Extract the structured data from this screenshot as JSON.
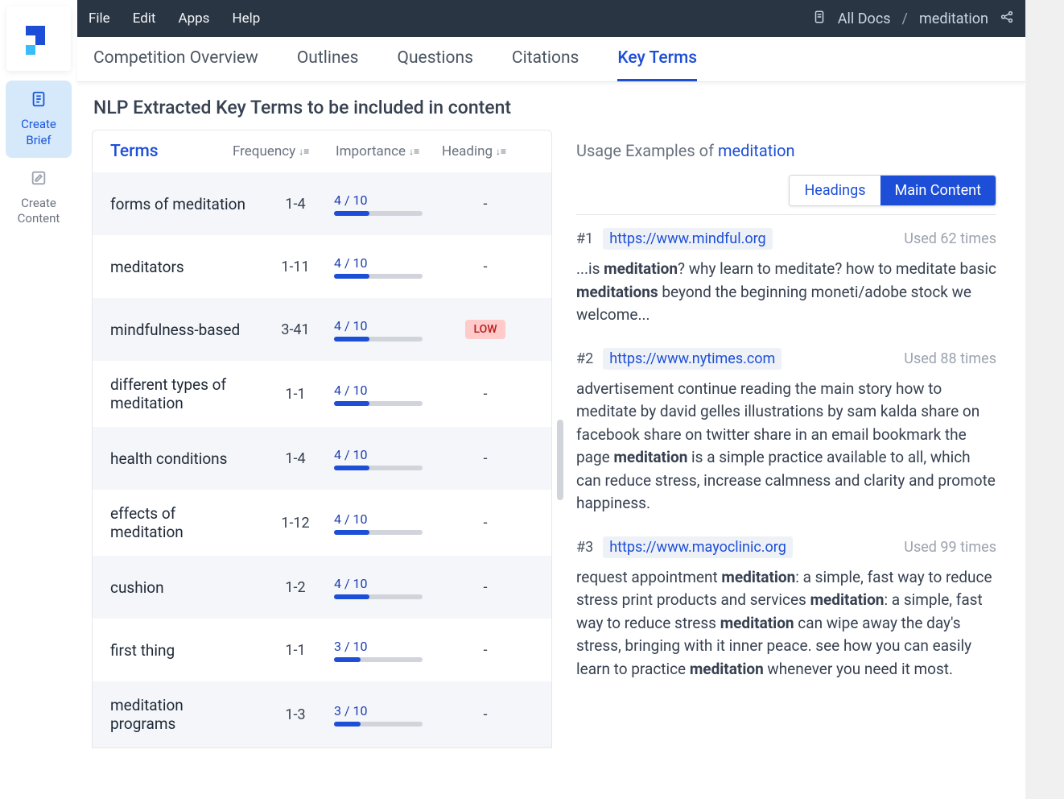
{
  "topmenu": {
    "file": "File",
    "edit": "Edit",
    "apps": "Apps",
    "help": "Help"
  },
  "breadcrumb": {
    "alldocs": "All Docs",
    "sep": "/",
    "doc": "meditation"
  },
  "sidebar": {
    "brief": "Create Brief",
    "content": "Create Content"
  },
  "tabs": {
    "overview": "Competition Overview",
    "outlines": "Outlines",
    "questions": "Questions",
    "citations": "Citations",
    "keyterms": "Key Terms"
  },
  "pageTitle": "NLP Extracted Key Terms to be included in content",
  "termsHeader": {
    "terms": "Terms",
    "frequency": "Frequency",
    "importance": "Importance",
    "heading": "Heading"
  },
  "terms": [
    {
      "name": "forms of meditation",
      "freq": "1-4",
      "imp": "4 / 10",
      "pct": 40,
      "head": "-"
    },
    {
      "name": "meditators",
      "freq": "1-11",
      "imp": "4 / 10",
      "pct": 40,
      "head": "-"
    },
    {
      "name": "mindfulness-based",
      "freq": "3-41",
      "imp": "4 / 10",
      "pct": 40,
      "head": "LOW"
    },
    {
      "name": "different types of meditation",
      "freq": "1-1",
      "imp": "4 / 10",
      "pct": 40,
      "head": "-"
    },
    {
      "name": "health conditions",
      "freq": "1-4",
      "imp": "4 / 10",
      "pct": 40,
      "head": "-"
    },
    {
      "name": "effects of meditation",
      "freq": "1-12",
      "imp": "4 / 10",
      "pct": 40,
      "head": "-"
    },
    {
      "name": "cushion",
      "freq": "1-2",
      "imp": "4 / 10",
      "pct": 40,
      "head": "-"
    },
    {
      "name": "first thing",
      "freq": "1-1",
      "imp": "3 / 10",
      "pct": 30,
      "head": "-"
    },
    {
      "name": "meditation programs",
      "freq": "1-3",
      "imp": "3 / 10",
      "pct": 30,
      "head": "-"
    }
  ],
  "examples": {
    "titlePrefix": "Usage Examples of ",
    "titleTerm": "meditation",
    "toggle": {
      "headings": "Headings",
      "main": "Main Content"
    },
    "items": [
      {
        "num": "#1",
        "url": "https://www.mindful.org",
        "count": "Used 62 times",
        "html": "...is <b>meditation</b>? why learn to meditate? how to meditate basic <b>meditations</b> beyond the beginning moneti/adobe stock we welcome..."
      },
      {
        "num": "#2",
        "url": "https://www.nytimes.com",
        "count": "Used 88 times",
        "html": "advertisement continue reading the main story how to meditate by david gelles illustrations by sam kalda share on facebook share on twitter share in an email bookmark the page <b>meditation</b> is a simple practice available to all, which can reduce stress, increase calmness and clarity and promote happiness."
      },
      {
        "num": "#3",
        "url": "https://www.mayoclinic.org",
        "count": "Used 99 times",
        "html": "request appointment <b>meditation</b>: a simple, fast way to reduce stress print products and services <b>meditation</b>: a simple, fast way to reduce stress <b>meditation</b> can wipe away the day's stress, bringing with it inner peace. see how you can easily learn to practice <b>meditation</b> whenever you need it most."
      }
    ]
  }
}
